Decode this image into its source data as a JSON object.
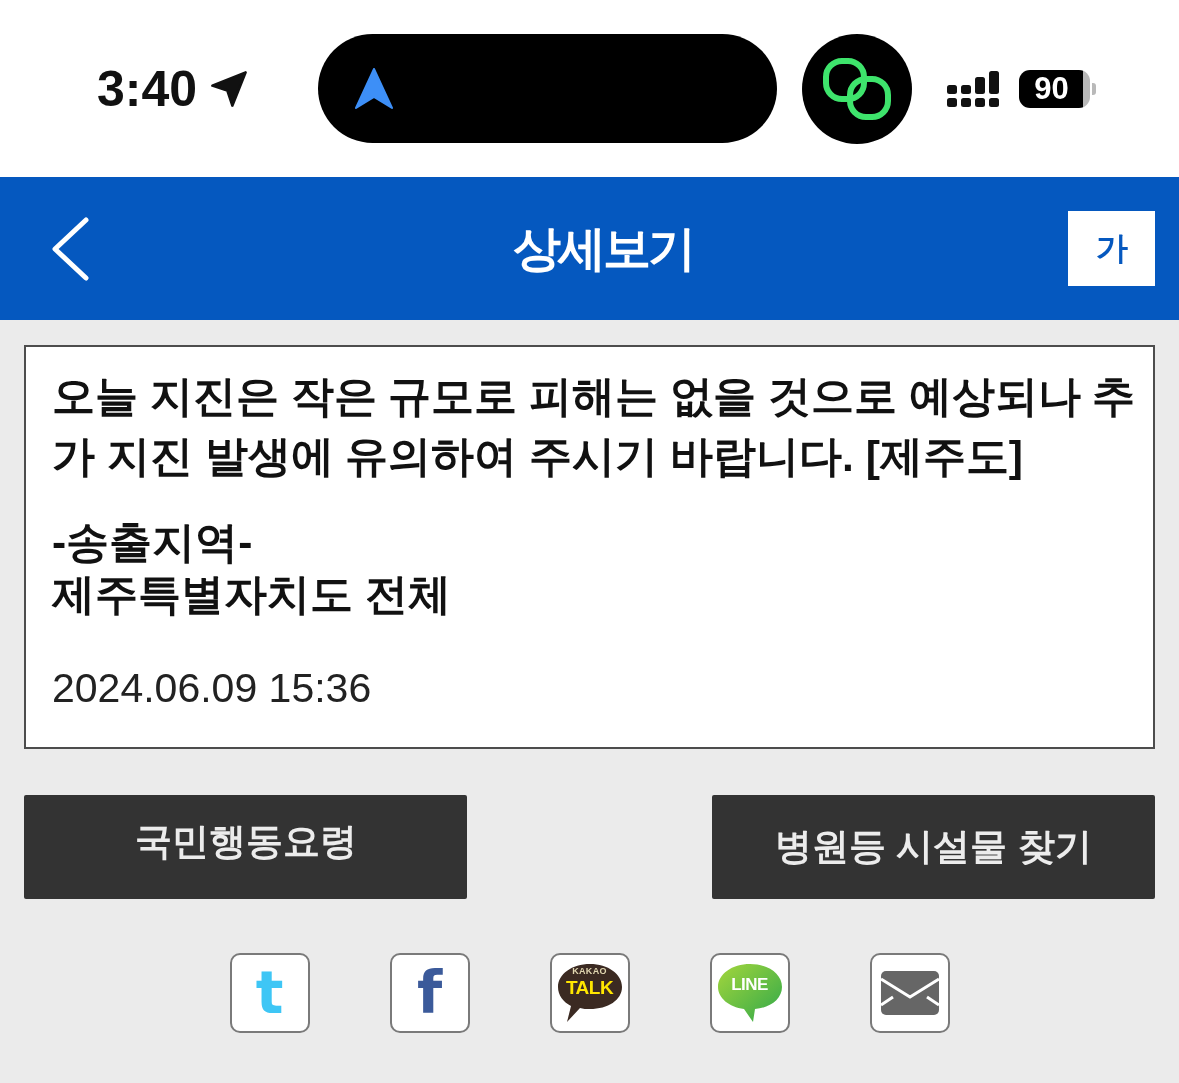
{
  "status_bar": {
    "time": "3:40",
    "battery": "90"
  },
  "header": {
    "title": "상세보기",
    "font_button": "가"
  },
  "message": {
    "text": "오늘 지진은 작은 규모로 피해는 없을 것으로 예상되나 추가 지진 발생에 유의하여 주시기 바랍니다. [제주도]",
    "region_label": "-송출지역-",
    "region": "제주특별자치도 전체",
    "timestamp": "2024.06.09 15:36"
  },
  "buttons": [
    "국민행동요령",
    "병원등 시설물 찾기"
  ],
  "share": [
    {
      "kind": "letter",
      "label": "t",
      "color": "#3ec6f5"
    },
    {
      "kind": "letter",
      "label": "f",
      "color": "#3b5a9a"
    },
    {
      "kind": "talk",
      "label": "TALK",
      "caption": "KAKAO"
    },
    {
      "kind": "line",
      "label": "LINE"
    },
    {
      "kind": "mail"
    }
  ]
}
